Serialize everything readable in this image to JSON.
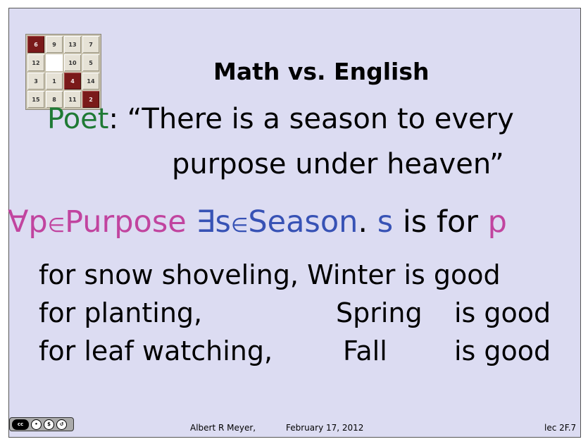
{
  "puzzle": {
    "tiles": [
      {
        "label": "6",
        "dark": true
      },
      {
        "label": "9",
        "dark": false
      },
      {
        "label": "13",
        "dark": false
      },
      {
        "label": "7",
        "dark": false
      },
      {
        "label": "12",
        "dark": false
      },
      {
        "label": "",
        "blank": true
      },
      {
        "label": "10",
        "dark": false
      },
      {
        "label": "5",
        "dark": false
      },
      {
        "label": "3",
        "dark": false
      },
      {
        "label": "1",
        "dark": false
      },
      {
        "label": "4",
        "dark": true
      },
      {
        "label": "14",
        "dark": false
      },
      {
        "label": "15",
        "dark": false
      },
      {
        "label": "8",
        "dark": false
      },
      {
        "label": "11",
        "dark": false
      },
      {
        "label": "2",
        "dark": true
      }
    ]
  },
  "title": "Math vs. English",
  "quote": {
    "speaker": "Poet",
    "line1": ": “There is a season to every",
    "line2": "purpose under heaven”"
  },
  "logic": {
    "forall": "∀p",
    "elem1": "∈",
    "purpose": "Purpose",
    "exists": "∃s",
    "elem2": "∈",
    "season": "Season",
    "dot": ".",
    "s": "s",
    "isfor": "is for",
    "p": "p"
  },
  "examples": [
    {
      "activity": "for snow shoveling, Winter is good",
      "season": "",
      "good": ""
    },
    {
      "activity": "for planting,",
      "season": "Spring",
      "good": "is good"
    },
    {
      "activity": "for leaf watching,",
      "season": "Fall",
      "good": "is good"
    }
  ],
  "footer": {
    "author": "Albert R Meyer,",
    "date": "February 17, 2012",
    "lecture": "lec 2F.7",
    "license_badge": "cc"
  }
}
